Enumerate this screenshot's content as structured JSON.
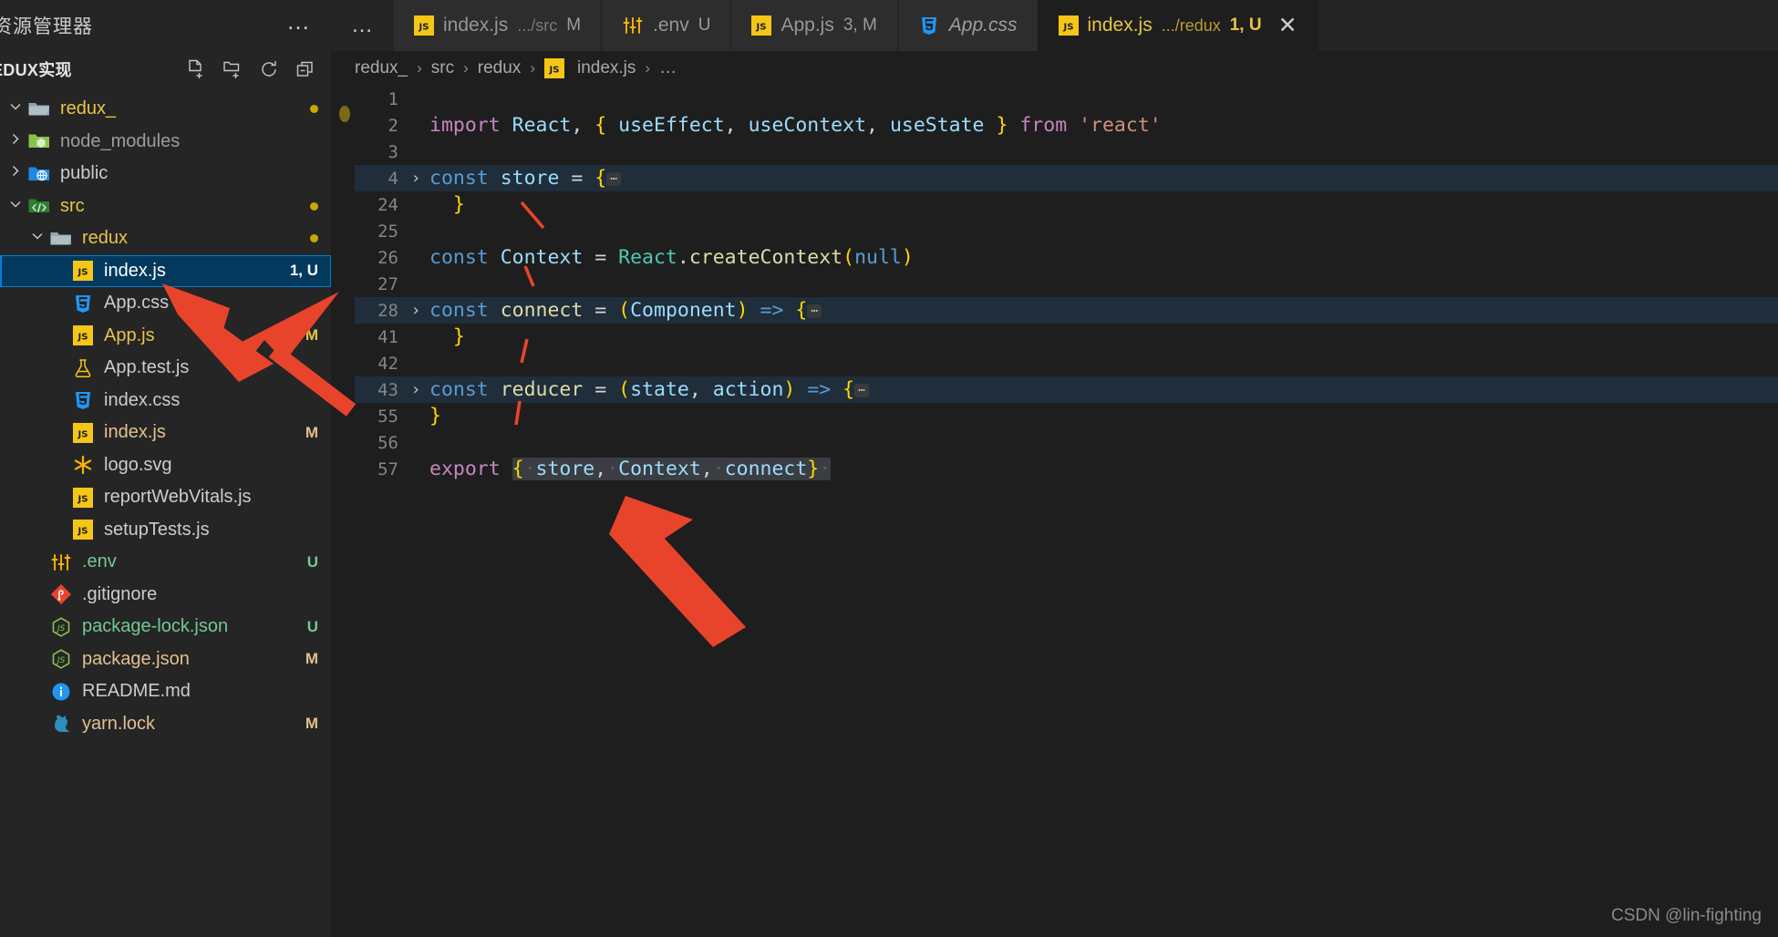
{
  "sidebar": {
    "explorer_title": "资源管理器",
    "more_actions": "…",
    "section_title": "EDUX实现",
    "actions": [
      {
        "name": "new-file-icon",
        "label": "新建文件"
      },
      {
        "name": "new-folder-icon",
        "label": "新建文件夹"
      },
      {
        "name": "refresh-icon",
        "label": "刷新资源管理器"
      },
      {
        "name": "collapse-all-icon",
        "label": "在资源管理器中折叠文件夹"
      }
    ],
    "tree": [
      {
        "name": "redux_",
        "icon": "folder-open-icon",
        "indent": 0,
        "chevron": "down",
        "color": "#e7c547",
        "badge": "",
        "dot": true,
        "selected": false
      },
      {
        "name": "node_modules",
        "icon": "folder-node-icon",
        "indent": 0,
        "chevron": "right",
        "color": "#9d9d9d",
        "badge": "",
        "dot": false,
        "selected": false
      },
      {
        "name": "public",
        "icon": "folder-public-icon",
        "indent": 0,
        "chevron": "right",
        "color": "#cccccc",
        "badge": "",
        "dot": false,
        "selected": false
      },
      {
        "name": "src",
        "icon": "folder-src-icon",
        "indent": 0,
        "chevron": "down",
        "color": "#e7c547",
        "badge": "",
        "dot": true,
        "selected": false
      },
      {
        "name": "redux",
        "icon": "folder-open-icon",
        "indent": 1,
        "chevron": "down",
        "color": "#e7c547",
        "badge": "",
        "dot": true,
        "selected": false
      },
      {
        "name": "index.js",
        "icon": "js-icon",
        "indent": 2,
        "chevron": "none",
        "color": "#ffffff",
        "badge": "1, U",
        "badge_color": "#ffffff",
        "dot": false,
        "selected": true
      },
      {
        "name": "App.css",
        "icon": "css-icon",
        "indent": 2,
        "chevron": "none",
        "color": "#cccccc",
        "badge": "",
        "dot": false,
        "selected": false
      },
      {
        "name": "App.js",
        "icon": "js-icon",
        "indent": 2,
        "chevron": "none",
        "color": "#e7c547",
        "badge": "3, M",
        "badge_color": "#e7c547",
        "dot": false,
        "selected": false
      },
      {
        "name": "App.test.js",
        "icon": "test-icon",
        "indent": 2,
        "chevron": "none",
        "color": "#cccccc",
        "badge": "",
        "dot": false,
        "selected": false
      },
      {
        "name": "index.css",
        "icon": "css-icon",
        "indent": 2,
        "chevron": "none",
        "color": "#cccccc",
        "badge": "",
        "dot": false,
        "selected": false
      },
      {
        "name": "index.js",
        "icon": "js-icon",
        "indent": 2,
        "chevron": "none",
        "color": "#e3c08d",
        "badge": "M",
        "badge_color": "#e3c08d",
        "dot": false,
        "selected": false
      },
      {
        "name": "logo.svg",
        "icon": "svg-icon",
        "indent": 2,
        "chevron": "none",
        "color": "#cccccc",
        "badge": "",
        "dot": false,
        "selected": false
      },
      {
        "name": "reportWebVitals.js",
        "icon": "js-icon",
        "indent": 2,
        "chevron": "none",
        "color": "#cccccc",
        "badge": "",
        "dot": false,
        "selected": false
      },
      {
        "name": "setupTests.js",
        "icon": "js-icon",
        "indent": 2,
        "chevron": "none",
        "color": "#cccccc",
        "badge": "",
        "dot": false,
        "selected": false
      },
      {
        "name": ".env",
        "icon": "env-icon",
        "indent": 1,
        "chevron": "none",
        "color": "#73c991",
        "badge": "U",
        "badge_color": "#73c991",
        "dot": false,
        "selected": false
      },
      {
        "name": ".gitignore",
        "icon": "git-icon",
        "indent": 1,
        "chevron": "none",
        "color": "#cccccc",
        "badge": "",
        "dot": false,
        "selected": false
      },
      {
        "name": "package-lock.json",
        "icon": "node-icon",
        "indent": 1,
        "chevron": "none",
        "color": "#73c991",
        "badge": "U",
        "badge_color": "#73c991",
        "dot": false,
        "selected": false
      },
      {
        "name": "package.json",
        "icon": "node-icon",
        "indent": 1,
        "chevron": "none",
        "color": "#e3c08d",
        "badge": "M",
        "badge_color": "#e3c08d",
        "dot": false,
        "selected": false
      },
      {
        "name": "README.md",
        "icon": "info-icon",
        "indent": 1,
        "chevron": "none",
        "color": "#cccccc",
        "badge": "",
        "dot": false,
        "selected": false
      },
      {
        "name": "yarn.lock",
        "icon": "yarn-icon",
        "indent": 1,
        "chevron": "none",
        "color": "#e3c08d",
        "badge": "M",
        "badge_color": "#e3c08d",
        "dot": false,
        "selected": false
      }
    ]
  },
  "tabs": {
    "overflow_dots": "…",
    "items": [
      {
        "label": "index.js",
        "path": ".../src",
        "badge": "M",
        "icon": "js-icon",
        "active": false,
        "italic": false,
        "closable": false
      },
      {
        "label": ".env",
        "path": "",
        "badge": "U",
        "icon": "env-icon",
        "active": false,
        "italic": false,
        "closable": false
      },
      {
        "label": "App.js",
        "path": "",
        "badge": "3, M",
        "icon": "js-icon",
        "active": false,
        "italic": false,
        "closable": false
      },
      {
        "label": "App.css",
        "path": "",
        "badge": "",
        "icon": "css-icon",
        "active": false,
        "italic": true,
        "closable": false
      },
      {
        "label": "index.js",
        "path": ".../redux",
        "badge": "1, U",
        "icon": "js-icon",
        "active": true,
        "italic": false,
        "closable": true
      }
    ],
    "close_glyph": "✕"
  },
  "breadcrumb": {
    "items": [
      "redux_",
      "src",
      "redux",
      "index.js",
      "…"
    ],
    "separator": "›",
    "file_icon": "js-icon"
  },
  "code": {
    "folded_ellipsis": "⋯",
    "lines": [
      {
        "n": "1",
        "fold": "",
        "highlight": false,
        "tokens": []
      },
      {
        "n": "2",
        "fold": "",
        "highlight": false,
        "tokens": [
          {
            "t": "import",
            "c": "kw"
          },
          {
            "t": " ",
            "c": "op"
          },
          {
            "t": "React",
            "c": "var"
          },
          {
            "t": ",",
            "c": "op"
          },
          {
            "t": " ",
            "c": "op"
          },
          {
            "t": "{",
            "c": "brk1"
          },
          {
            "t": " ",
            "c": "op"
          },
          {
            "t": "useEffect",
            "c": "var"
          },
          {
            "t": ",",
            "c": "op"
          },
          {
            "t": " ",
            "c": "op"
          },
          {
            "t": "useContext",
            "c": "var"
          },
          {
            "t": ",",
            "c": "op"
          },
          {
            "t": " ",
            "c": "op"
          },
          {
            "t": "useState",
            "c": "var"
          },
          {
            "t": " ",
            "c": "op"
          },
          {
            "t": "}",
            "c": "brk1"
          },
          {
            "t": " ",
            "c": "op"
          },
          {
            "t": "from",
            "c": "kw"
          },
          {
            "t": " ",
            "c": "op"
          },
          {
            "t": "'react'",
            "c": "str"
          }
        ]
      },
      {
        "n": "3",
        "fold": "",
        "highlight": false,
        "tokens": []
      },
      {
        "n": "4",
        "fold": "›",
        "highlight": true,
        "tokens": [
          {
            "t": "const",
            "c": "decl"
          },
          {
            "t": " ",
            "c": "op"
          },
          {
            "t": "store",
            "c": "var"
          },
          {
            "t": " ",
            "c": "op"
          },
          {
            "t": "=",
            "c": "op"
          },
          {
            "t": " ",
            "c": "op"
          },
          {
            "t": "{",
            "c": "brk1"
          },
          {
            "t": "⋯",
            "c": "ell"
          }
        ]
      },
      {
        "n": "24",
        "fold": "",
        "highlight": false,
        "tokens": [
          {
            "t": "  ",
            "c": "op"
          },
          {
            "t": "}",
            "c": "brk1"
          }
        ]
      },
      {
        "n": "25",
        "fold": "",
        "highlight": false,
        "tokens": []
      },
      {
        "n": "26",
        "fold": "",
        "highlight": false,
        "tokens": [
          {
            "t": "const",
            "c": "decl"
          },
          {
            "t": " ",
            "c": "op"
          },
          {
            "t": "Context",
            "c": "var"
          },
          {
            "t": " ",
            "c": "op"
          },
          {
            "t": "=",
            "c": "op"
          },
          {
            "t": " ",
            "c": "op"
          },
          {
            "t": "React",
            "c": "cls"
          },
          {
            "t": ".",
            "c": "op"
          },
          {
            "t": "createContext",
            "c": "fn"
          },
          {
            "t": "(",
            "c": "brk1"
          },
          {
            "t": "null",
            "c": "nul"
          },
          {
            "t": ")",
            "c": "brk1"
          }
        ]
      },
      {
        "n": "27",
        "fold": "",
        "highlight": false,
        "tokens": []
      },
      {
        "n": "28",
        "fold": "›",
        "highlight": true,
        "tokens": [
          {
            "t": "const",
            "c": "decl"
          },
          {
            "t": " ",
            "c": "op"
          },
          {
            "t": "connect",
            "c": "fn"
          },
          {
            "t": " ",
            "c": "op"
          },
          {
            "t": "=",
            "c": "op"
          },
          {
            "t": " ",
            "c": "op"
          },
          {
            "t": "(",
            "c": "brk1"
          },
          {
            "t": "Component",
            "c": "var"
          },
          {
            "t": ")",
            "c": "brk1"
          },
          {
            "t": " ",
            "c": "op"
          },
          {
            "t": "=>",
            "c": "decl"
          },
          {
            "t": " ",
            "c": "op"
          },
          {
            "t": "{",
            "c": "brk1"
          },
          {
            "t": "⋯",
            "c": "ell"
          }
        ]
      },
      {
        "n": "41",
        "fold": "",
        "highlight": false,
        "tokens": [
          {
            "t": "  ",
            "c": "op"
          },
          {
            "t": "}",
            "c": "brk1"
          }
        ]
      },
      {
        "n": "42",
        "fold": "",
        "highlight": false,
        "tokens": []
      },
      {
        "n": "43",
        "fold": "›",
        "highlight": true,
        "tokens": [
          {
            "t": "const",
            "c": "decl"
          },
          {
            "t": " ",
            "c": "op"
          },
          {
            "t": "reducer",
            "c": "fn"
          },
          {
            "t": " ",
            "c": "op"
          },
          {
            "t": "=",
            "c": "op"
          },
          {
            "t": " ",
            "c": "op"
          },
          {
            "t": "(",
            "c": "brk1"
          },
          {
            "t": "state",
            "c": "var"
          },
          {
            "t": ",",
            "c": "op"
          },
          {
            "t": " ",
            "c": "op"
          },
          {
            "t": "action",
            "c": "var"
          },
          {
            "t": ")",
            "c": "brk1"
          },
          {
            "t": " ",
            "c": "op"
          },
          {
            "t": "=>",
            "c": "decl"
          },
          {
            "t": " ",
            "c": "op"
          },
          {
            "t": "{",
            "c": "brk1"
          },
          {
            "t": "⋯",
            "c": "ell"
          }
        ]
      },
      {
        "n": "55",
        "fold": "",
        "highlight": false,
        "tokens": [
          {
            "t": "}",
            "c": "brk1"
          }
        ]
      },
      {
        "n": "56",
        "fold": "",
        "highlight": false,
        "tokens": []
      },
      {
        "n": "57",
        "fold": "",
        "highlight": false,
        "selection": true,
        "tokens": [
          {
            "t": "export",
            "c": "kw"
          },
          {
            "t": " ",
            "c": "op"
          }
        ],
        "selected_tokens": [
          {
            "t": "{",
            "c": "brk1"
          },
          {
            "t": "·",
            "c": "ws"
          },
          {
            "t": "store",
            "c": "var"
          },
          {
            "t": ",",
            "c": "op"
          },
          {
            "t": "·",
            "c": "ws"
          },
          {
            "t": "Context",
            "c": "var"
          },
          {
            "t": ",",
            "c": "op"
          },
          {
            "t": "·",
            "c": "ws"
          },
          {
            "t": "connect",
            "c": "var"
          },
          {
            "t": "}",
            "c": "brk1"
          },
          {
            "t": "·",
            "c": "ws"
          }
        ]
      }
    ]
  },
  "annotations": {
    "arrow_color": "#e8442c",
    "arrows": [
      "arrow-to-app-css",
      "arrow-to-export-line"
    ]
  },
  "watermark": "CSDN @lin-fighting"
}
